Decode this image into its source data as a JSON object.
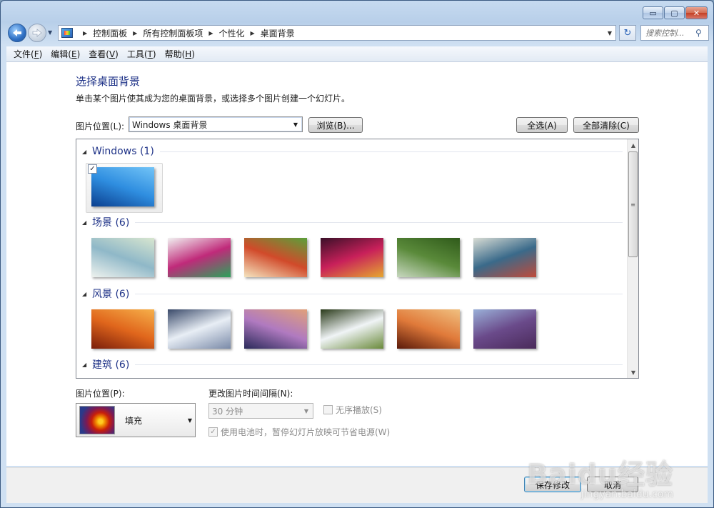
{
  "window": {
    "caption": {
      "minimize": "▭",
      "maximize": "▢",
      "close": "✕"
    }
  },
  "address_bar": {
    "crumbs": [
      "控制面板",
      "所有控制面板项",
      "个性化",
      "桌面背景"
    ],
    "refresh_icon": "refresh-icon",
    "search_placeholder": "搜索控制..."
  },
  "menu": {
    "items": [
      {
        "label": "文件(",
        "key": "F",
        "tail": ")"
      },
      {
        "label": "编辑(",
        "key": "E",
        "tail": ")"
      },
      {
        "label": "查看(",
        "key": "V",
        "tail": ")"
      },
      {
        "label": "工具(",
        "key": "T",
        "tail": ")"
      },
      {
        "label": "帮助(",
        "key": "H",
        "tail": ")"
      }
    ]
  },
  "main": {
    "title": "选择桌面背景",
    "description": "单击某个图片使其成为您的桌面背景，或选择多个图片创建一个幻灯片。",
    "location_label": "图片位置(L):",
    "location_value": "Windows 桌面背景",
    "browse_button": "浏览(B)...",
    "select_all_button": "全选(A)",
    "clear_all_button": "全部清除(C)"
  },
  "gallery": {
    "groups": [
      {
        "name": "Windows (1)",
        "thumbs": [
          {
            "checked": true,
            "colors": [
              "#0b3f8f",
              "#2f8ee0",
              "#72c4f7"
            ]
          }
        ]
      },
      {
        "name": "场景 (6)",
        "thumbs": [
          {
            "colors": [
              "#eef2ee",
              "#8fb8c8",
              "#d8e6cf"
            ]
          },
          {
            "colors": [
              "#f1f1f1",
              "#c02a7a",
              "#2aa35a"
            ]
          },
          {
            "colors": [
              "#f5e5c0",
              "#d14a2a",
              "#5aa03a"
            ]
          },
          {
            "colors": [
              "#3a1028",
              "#c8205a",
              "#e6a830"
            ]
          },
          {
            "colors": [
              "#c8d8c0",
              "#5a8a3a",
              "#2f5a1a"
            ]
          },
          {
            "colors": [
              "#d8dcd4",
              "#3a6a8a",
              "#c04a3a"
            ]
          }
        ]
      },
      {
        "name": "风景 (6)",
        "thumbs": [
          {
            "colors": [
              "#7a1e0a",
              "#e0661c",
              "#f6b04a"
            ]
          },
          {
            "colors": [
              "#3a4a6a",
              "#e8eef5",
              "#7a8aa8"
            ]
          },
          {
            "colors": [
              "#2a2a5a",
              "#b07ac0",
              "#e0a07a"
            ]
          },
          {
            "colors": [
              "#2a3a1a",
              "#f0f4f6",
              "#6a8a3a"
            ]
          },
          {
            "colors": [
              "#5a1a0a",
              "#e07a3a",
              "#f0c080"
            ]
          },
          {
            "colors": [
              "#9ab0d8",
              "#6a4a8a",
              "#4a2a5a"
            ]
          }
        ]
      },
      {
        "name": "建筑 (6)",
        "thumbs": []
      }
    ]
  },
  "bottom": {
    "position_label": "图片位置(P):",
    "position_value": "填充",
    "interval_label": "更改图片时间间隔(N):",
    "interval_value": "30 分钟",
    "shuffle_label": "无序播放(S)",
    "battery_label": "使用电池时，暂停幻灯片放映可节省电源(W)",
    "battery_checked": true
  },
  "footer": {
    "save_button": "保存修改",
    "cancel_button": "取消"
  },
  "watermark": {
    "text": "Baidu经验",
    "sub": "jingyan.baidu.com"
  }
}
